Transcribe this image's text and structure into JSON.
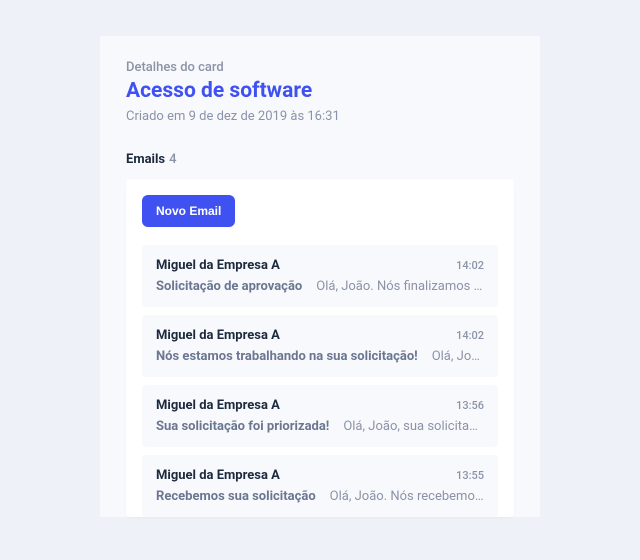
{
  "header": {
    "overline": "Detalhes do card",
    "title": "Acesso de software",
    "created_at": "Criado em 9 de dez de 2019 às 16:31"
  },
  "emails_section": {
    "label": "Emails",
    "count": "4",
    "new_email_label": "Novo Email",
    "items": [
      {
        "sender": "Miguel da Empresa A",
        "time": "14:02",
        "subject": "Solicitação de aprovação",
        "preview": "Olá, João. Nós finalizamos sua..."
      },
      {
        "sender": "Miguel da Empresa A",
        "time": "14:02",
        "subject": "Nós estamos trabalhando na sua solicitação!",
        "preview": "Olá, João..."
      },
      {
        "sender": "Miguel da Empresa A",
        "time": "13:56",
        "subject": "Sua solicitação foi priorizada!",
        "preview": "Olá, João, sua solicitação..."
      },
      {
        "sender": "Miguel da Empresa A",
        "time": "13:55",
        "subject": "Recebemos sua solicitação",
        "preview": "Olá, João. Nós recebemos a..."
      }
    ]
  }
}
